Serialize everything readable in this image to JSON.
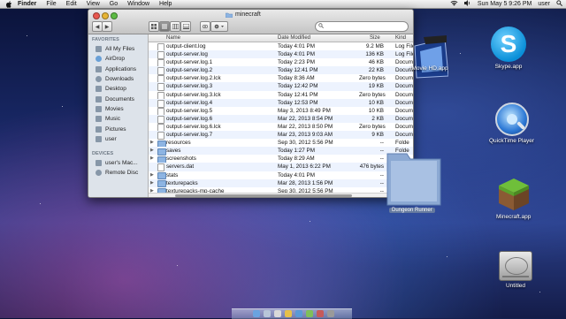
{
  "menubar": {
    "items": [
      "Finder",
      "File",
      "Edit",
      "View",
      "Go",
      "Window",
      "Help"
    ],
    "clock": "Sun May 5  9:26 PM",
    "user": "user"
  },
  "window": {
    "title": "minecraft",
    "search_placeholder": "",
    "columns": {
      "name": "Name",
      "date": "Date Modified",
      "size": "Size",
      "kind": "Kind"
    },
    "sidebar": {
      "favorites_header": "FAVORITES",
      "favorites": [
        "All My Files",
        "AirDrop",
        "Applications",
        "Downloads",
        "Desktop",
        "Documents",
        "Movies",
        "Music",
        "Pictures",
        "user"
      ],
      "devices_header": "DEVICES",
      "devices": [
        "user's Mac...",
        "Remote Disc"
      ]
    },
    "files": [
      {
        "name": "output-client.log",
        "date": "Today 4:01 PM",
        "size": "9.2 MB",
        "kind": "Log File",
        "type": "file"
      },
      {
        "name": "output-server.log",
        "date": "Today 4:01 PM",
        "size": "136 KB",
        "kind": "Log File",
        "type": "file"
      },
      {
        "name": "output-server.log.1",
        "date": "Today 2:23 PM",
        "size": "46 KB",
        "kind": "Docum",
        "type": "file"
      },
      {
        "name": "output-server.log.2",
        "date": "Today 12:41 PM",
        "size": "22 KB",
        "kind": "Docum",
        "type": "file"
      },
      {
        "name": "output-server.log.2.lck",
        "date": "Today 8:36 AM",
        "size": "Zero bytes",
        "kind": "Docum",
        "type": "file"
      },
      {
        "name": "output-server.log.3",
        "date": "Today 12:42 PM",
        "size": "19 KB",
        "kind": "Docum",
        "type": "file"
      },
      {
        "name": "output-server.log.3.lck",
        "date": "Today 12:41 PM",
        "size": "Zero bytes",
        "kind": "Docum",
        "type": "file"
      },
      {
        "name": "output-server.log.4",
        "date": "Today 12:53 PM",
        "size": "10 KB",
        "kind": "Docum",
        "type": "file"
      },
      {
        "name": "output-server.log.5",
        "date": "May 3, 2013 8:49 PM",
        "size": "10 KB",
        "kind": "Docum",
        "type": "file"
      },
      {
        "name": "output-server.log.6",
        "date": "Mar 22, 2013 8:54 PM",
        "size": "2 KB",
        "kind": "Docum",
        "type": "file"
      },
      {
        "name": "output-server.log.6.lck",
        "date": "Mar 22, 2013 8:50 PM",
        "size": "Zero bytes",
        "kind": "Docum",
        "type": "file"
      },
      {
        "name": "output-server.log.7",
        "date": "Mar 23, 2013 9:03 AM",
        "size": "9 KB",
        "kind": "Docum",
        "type": "file"
      },
      {
        "name": "resources",
        "date": "Sep 30, 2012 5:56 PM",
        "size": "--",
        "kind": "Folde",
        "type": "folder"
      },
      {
        "name": "saves",
        "date": "Today 1:27 PM",
        "size": "--",
        "kind": "Folde",
        "type": "folder"
      },
      {
        "name": "screenshots",
        "date": "Today 8:29 AM",
        "size": "--",
        "kind": "Folde",
        "type": "folder"
      },
      {
        "name": "servers.dat",
        "date": "May 1, 2013 6:22 PM",
        "size": "476 bytes",
        "kind": "Docum",
        "type": "file"
      },
      {
        "name": "stats",
        "date": "Today 4:01 PM",
        "size": "--",
        "kind": "Folde",
        "type": "folder"
      },
      {
        "name": "texturepacks",
        "date": "Mar 28, 2013 1:56 PM",
        "size": "--",
        "kind": "Folde",
        "type": "folder"
      },
      {
        "name": "texturepacks-mp-cache",
        "date": "Sep 30, 2012 5:56 PM",
        "size": "--",
        "kind": "Folde",
        "type": "folder"
      }
    ]
  },
  "desktop": {
    "icons": [
      {
        "label": "Skype.app",
        "icon": "skype-icon"
      },
      {
        "label": "QuickTime Player",
        "icon": "quicktime-icon"
      },
      {
        "label": "Minecraft.app",
        "icon": "minecraft-icon"
      },
      {
        "label": "Untitled",
        "icon": "hard-drive-icon"
      },
      {
        "label": "iMovie HD.app",
        "icon": "imovie-icon"
      },
      {
        "label": "Dungeon Runner",
        "icon": "folder-icon"
      }
    ]
  },
  "colors": {
    "selection": "#edf3fe",
    "sidebar": "#dde3ea",
    "folder": "#8db4e2"
  }
}
